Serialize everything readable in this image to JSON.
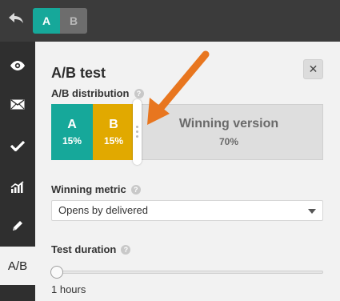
{
  "topbar": {
    "variant_a": "A",
    "variant_b": "B"
  },
  "sidebar": {
    "items": [
      {
        "icon": "eye-icon"
      },
      {
        "icon": "envelope-icon"
      },
      {
        "icon": "checkmark-icon"
      },
      {
        "icon": "chart-icon"
      },
      {
        "icon": "pencil-icon"
      },
      {
        "label": "A/B",
        "active": true
      }
    ]
  },
  "panel": {
    "title": "A/B test",
    "close": "✕",
    "distribution_label": "A/B distribution",
    "help": "?",
    "distribution": {
      "a": {
        "letter": "A",
        "pct": "15%"
      },
      "b": {
        "letter": "B",
        "pct": "15%"
      },
      "winning": {
        "title": "Winning version",
        "pct": "70%"
      }
    },
    "winning_metric_label": "Winning metric",
    "winning_metric_value": "Opens by delivered",
    "test_duration_label": "Test duration",
    "test_duration_value": "1 hours"
  },
  "colors": {
    "variant_a": "#16a89a",
    "variant_b": "#e1a900",
    "arrow": "#e8761f"
  }
}
